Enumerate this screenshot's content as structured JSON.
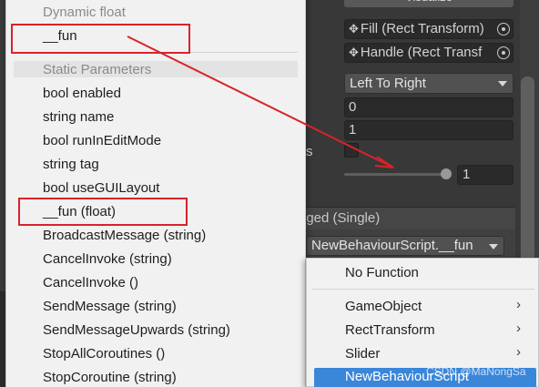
{
  "inspector": {
    "top_button_label": "Visualize",
    "fill_field": {
      "icon": "rect-transform-icon",
      "label": "Fill (Rect Transform)"
    },
    "handle_field": {
      "icon": "rect-transform-icon",
      "label": "Handle (Rect Transf"
    },
    "direction_dropdown": "Left To Right",
    "min_value": "0",
    "max_value": "1",
    "slider_value": "1",
    "side_letter": "s",
    "event_header": "nged (Single)",
    "event_function": "NewBehaviourScript.__fun"
  },
  "left_menu": {
    "dynamic_section": "Dynamic float",
    "dynamic_items": [
      "__fun"
    ],
    "static_section": "Static Parameters",
    "static_items": [
      "bool enabled",
      "string name",
      "bool runInEditMode",
      "string tag",
      "bool useGUILayout",
      "__fun (float)",
      "BroadcastMessage (string)",
      "CancelInvoke (string)",
      "CancelInvoke ()",
      "SendMessage (string)",
      "SendMessageUpwards (string)",
      "StopAllCoroutines ()",
      "StopCoroutine (string)"
    ]
  },
  "right_menu": {
    "items": [
      {
        "label": "No Function",
        "has_submenu": false
      },
      {
        "label": "GameObject",
        "has_submenu": true
      },
      {
        "label": "RectTransform",
        "has_submenu": true
      },
      {
        "label": "Slider",
        "has_submenu": true
      },
      {
        "label": "NewBehaviourScript",
        "has_submenu": false,
        "selected": true
      }
    ],
    "submenu_arrow": "›"
  },
  "watermark": "CSDN @MaNongSa",
  "colors": {
    "annotation_red": "#d8232a",
    "selection_blue": "#3a86d9",
    "menu_bg": "#f1f1f1",
    "inspector_bg": "#383838"
  }
}
